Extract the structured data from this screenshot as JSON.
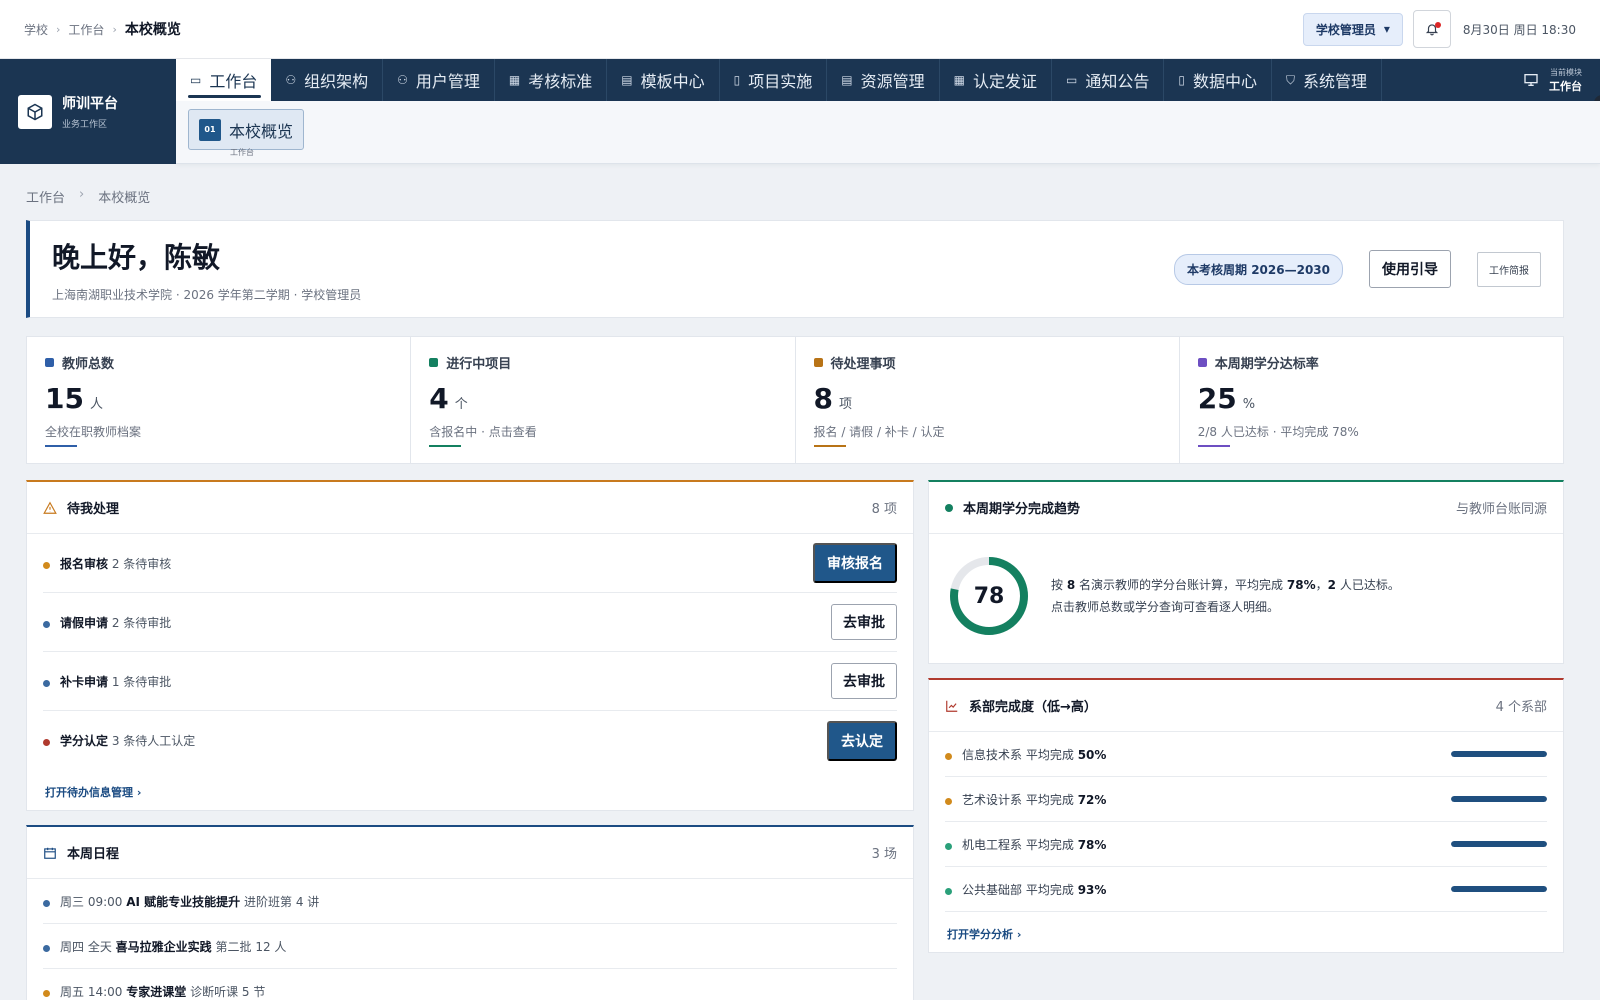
{
  "topbar": {
    "breadcrumb": [
      "学校",
      "工作台"
    ],
    "current": "本校概览",
    "role": "学校管理员",
    "datetime": "8月30日 周日 18:30"
  },
  "brand": {
    "title": "师训平台",
    "subtitle": "业务工作区"
  },
  "nav": {
    "items": [
      {
        "label": "工作台",
        "icon": "monitor-icon"
      },
      {
        "label": "组织架构",
        "icon": "users-icon"
      },
      {
        "label": "用户管理",
        "icon": "user-icon"
      },
      {
        "label": "考核标准",
        "icon": "grid-icon"
      },
      {
        "label": "模板中心",
        "icon": "calendar-icon"
      },
      {
        "label": "项目实施",
        "icon": "doc-icon"
      },
      {
        "label": "资源管理",
        "icon": "calendar-icon"
      },
      {
        "label": "认定发证",
        "icon": "grid-icon"
      },
      {
        "label": "通知公告",
        "icon": "monitor-icon"
      },
      {
        "label": "数据中心",
        "icon": "doc-icon"
      },
      {
        "label": "系统管理",
        "icon": "shield-icon"
      }
    ],
    "current_module_label": "当前模块",
    "current_module_value": "工作台"
  },
  "subnav": {
    "num": "01",
    "label": "本校概览",
    "caption": "工作台"
  },
  "page_breadcrumb": [
    "工作台",
    "本校概览"
  ],
  "greeting": {
    "title": "晚上好，陈敏",
    "subtitle": "上海南湖职业技术学院 · 2026 学年第二学期 · 学校管理员",
    "period": "本考核周期 2026—2030",
    "guide_btn": "使用引导",
    "report_btn": "工作简报"
  },
  "stats": [
    {
      "label": "教师总数",
      "value": "15",
      "unit": "人",
      "desc": "全校在职教师档案",
      "color": "#2f5fa8"
    },
    {
      "label": "进行中项目",
      "value": "4",
      "unit": "个",
      "desc": "含报名中 · 点击查看",
      "color": "#148060"
    },
    {
      "label": "待处理事项",
      "value": "8",
      "unit": "项",
      "desc": "报名 / 请假 / 补卡 / 认定",
      "color": "#b87316"
    },
    {
      "label": "本周期学分达标率",
      "value": "25",
      "unit": "%",
      "desc": "2/8 人已达标 · 平均完成 78%",
      "color": "#6d4fc2"
    }
  ],
  "todo": {
    "title": "待我处理",
    "count": "8 项",
    "items": [
      {
        "name": "报名审核",
        "detail": "2 条待审核",
        "action": "审核报名",
        "dot": "#d18a1c"
      },
      {
        "name": "请假申请",
        "detail": "2 条待审批",
        "action": "去审批",
        "dot": "#3b6aa0"
      },
      {
        "name": "补卡申请",
        "detail": "1 条待审批",
        "action": "去审批",
        "dot": "#3b6aa0"
      },
      {
        "name": "学分认定",
        "detail": "3 条待人工认定",
        "action": "去认定",
        "dot": "#b03a2e"
      }
    ],
    "link": "打开待办信息管理 ›"
  },
  "schedule": {
    "title": "本周日程",
    "count": "3 场",
    "items": [
      {
        "time": "周三 09:00",
        "name": "AI 赋能专业技能提升",
        "note": "进阶班第 4 讲",
        "dot": "#3b6aa0"
      },
      {
        "time": "周四 全天",
        "name": "喜马拉雅企业实践",
        "note": "第二批 12 人",
        "dot": "#3b6aa0"
      },
      {
        "time": "周五 14:00",
        "name": "专家进课堂",
        "note": "诊断听课 5 节",
        "dot": "#d18a1c"
      }
    ]
  },
  "trend": {
    "title": "本周期学分完成趋势",
    "right": "与教师台账同源",
    "value": "78",
    "percent": 78,
    "line1_a": "按",
    "line1_b": "8",
    "line1_c": "名演示教师的学分台账计算，平均完成",
    "line1_d": "78%",
    "line1_e": "，",
    "line1_f": "2",
    "line1_g": "人已达标。",
    "line2": "点击教师总数或学分查询可查看逐人明细。"
  },
  "depts": {
    "title": "系部完成度（低→高）",
    "count": "4 个系部",
    "items": [
      {
        "name": "信息技术系",
        "label": "平均完成",
        "value": "50%",
        "fill": 1.0,
        "dot": "#d18a1c"
      },
      {
        "name": "艺术设计系",
        "label": "平均完成",
        "value": "72%",
        "fill": 1.0,
        "dot": "#d18a1c"
      },
      {
        "name": "机电工程系",
        "label": "平均完成",
        "value": "78%",
        "fill": 1.0,
        "dot": "#2aa07a"
      },
      {
        "name": "公共基础部",
        "label": "平均完成",
        "value": "93%",
        "fill": 1.0,
        "dot": "#2aa07a"
      }
    ],
    "link": "打开学分分析 ›"
  }
}
